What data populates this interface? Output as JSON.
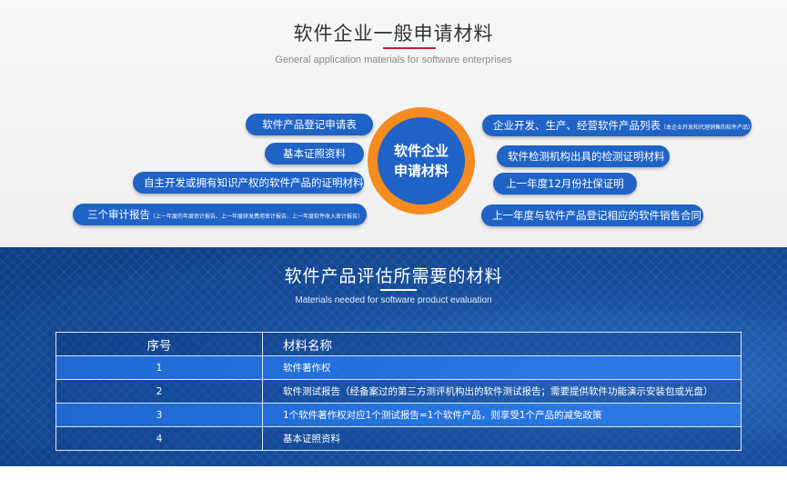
{
  "top": {
    "title": "软件企业一般申请材料",
    "subtitle": "General application materials for software enterprises",
    "center_line1": "软件企业",
    "center_line2": "申请材料",
    "left_items": [
      "软件产品登记申请表",
      "基本证照资料",
      "自主开发或拥有知识产权的软件产品的证明材料",
      "三个审计报告"
    ],
    "left_item4_note": "（上一年度的年度审计报告、上一年度研发费用审计报告、上一年度软件收入审计报告）",
    "right_items": [
      "企业开发、生产、经营软件产品列表",
      "软件检测机构出具的检测证明材料",
      "上一年度12月份社保证明",
      "上一年度与软件产品登记相应的软件销售合同"
    ],
    "right_item1_note": "（本企业开发和代理销售的软件产品）"
  },
  "bottom": {
    "title": "软件产品评估所需要的材料",
    "subtitle": "Materials needed for software product evaluation",
    "headers": [
      "序号",
      "材料名称"
    ],
    "rows": [
      {
        "no": "1",
        "name": "软件著作权"
      },
      {
        "no": "2",
        "name": "软件测试报告（经备案过的第三方测评机构出的软件测试报告；需要提供软件功能演示安装包或光盘）"
      },
      {
        "no": "3",
        "name": "1个软件著作权对应1个测试报告=1个软件产品，则享受1个产品的减免政策"
      },
      {
        "no": "4",
        "name": "基本证照资料"
      }
    ]
  },
  "colors": {
    "pill_blue": "#1f63c6",
    "ring_orange": "#f68b1f",
    "title_underline_red": "#c8202f"
  }
}
